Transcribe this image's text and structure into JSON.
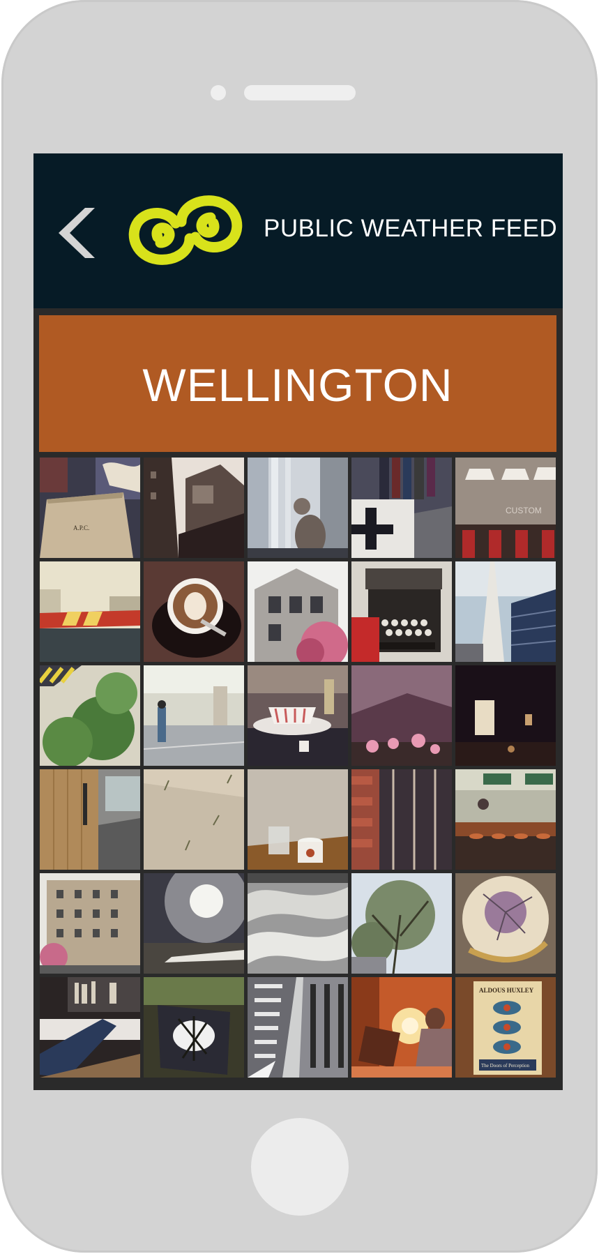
{
  "header": {
    "back_icon": "chevron-left-icon",
    "logo_icon": "koru-logo-icon",
    "title": "PUBLIC WEATHER FEED",
    "colors": {
      "background": "#061b26",
      "logo": "#d8e21b",
      "back": "#d0d0d0"
    }
  },
  "banner": {
    "city": "WELLINGTON",
    "color": "#b05a23"
  },
  "photo_grid": {
    "columns": 5,
    "rows": 6,
    "photos": [
      {
        "scene": "shopping-bag-photo",
        "text": "A.P.C."
      },
      {
        "scene": "buildings-photo"
      },
      {
        "scene": "cat-window-photo"
      },
      {
        "scene": "clothing-rack-photo"
      },
      {
        "scene": "cafe-counter-photo",
        "text": "CUSTOM"
      },
      {
        "scene": "rooftop-parking-photo"
      },
      {
        "scene": "latte-art-photo"
      },
      {
        "scene": "victorian-house-photo"
      },
      {
        "scene": "typewriter-photo"
      },
      {
        "scene": "skyscraper-photo"
      },
      {
        "scene": "trees-rooftop-photo"
      },
      {
        "scene": "person-rooftop-photo"
      },
      {
        "scene": "teacup-photo"
      },
      {
        "scene": "canyon-flowers-photo"
      },
      {
        "scene": "dark-bar-photo"
      },
      {
        "scene": "wooden-door-photo"
      },
      {
        "scene": "sand-plants-photo"
      },
      {
        "scene": "coffee-glass-table-photo"
      },
      {
        "scene": "brick-wall-photo"
      },
      {
        "scene": "restaurant-kitchen-photo"
      },
      {
        "scene": "apartment-building-photo"
      },
      {
        "scene": "beach-sun-photo"
      },
      {
        "scene": "sand-dunes-photo"
      },
      {
        "scene": "tree-branches-photo"
      },
      {
        "scene": "dried-flower-photo"
      },
      {
        "scene": "legs-desk-photo"
      },
      {
        "scene": "plant-reflection-photo"
      },
      {
        "scene": "tower-looking-up-photo"
      },
      {
        "scene": "reading-chair-photo"
      },
      {
        "scene": "book-cover-photo",
        "text": "ALDOUS HUXLEY",
        "text2": "The Doors of Perception"
      }
    ]
  }
}
